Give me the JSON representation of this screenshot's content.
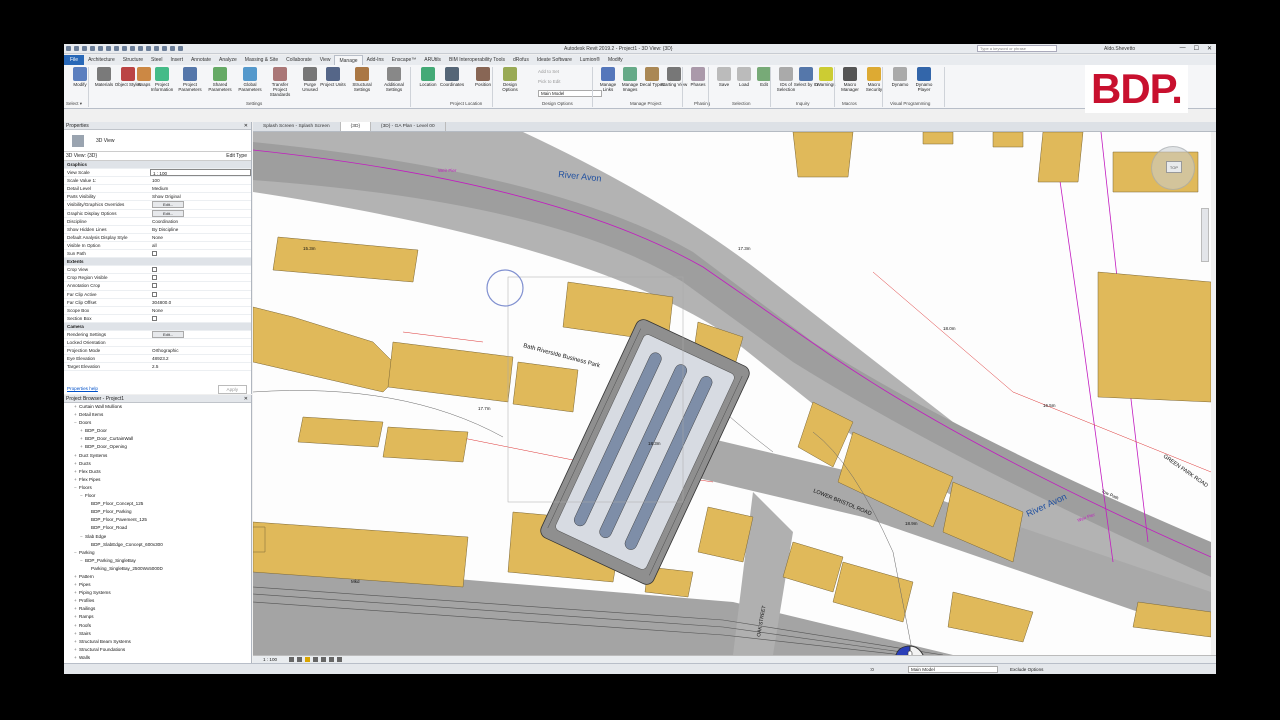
{
  "app": {
    "title": "Autodesk Revit 2019.2 - Project1 - 3D View: {3D}",
    "search_placeholder": "Type a keyword or phrase",
    "user": "Aldo.Shevetto",
    "brand_logo": "BDP."
  },
  "ribbon_tabs": [
    "File",
    "Architecture",
    "Structure",
    "Steel",
    "Insert",
    "Annotate",
    "Analyze",
    "Massing & Site",
    "Collaborate",
    "View",
    "Manage",
    "Add-Ins",
    "Enscape™",
    "ARUtils",
    "BIM Interoperability Tools",
    "dRofus",
    "Ideate Software",
    "Lumion®",
    "Modify"
  ],
  "active_tab": "Manage",
  "ribbon": {
    "buttons": [
      {
        "label": "Modify",
        "icon": "cursor-icon"
      },
      {
        "label": "Materials",
        "icon": "materials-icon"
      },
      {
        "label": "Object Styles",
        "icon": "object-styles-icon"
      },
      {
        "label": "Snaps",
        "icon": "snaps-icon"
      },
      {
        "label": "Project Information",
        "icon": "project-info-icon"
      },
      {
        "label": "Project Parameters",
        "icon": "project-params-icon"
      },
      {
        "label": "Shared Parameters",
        "icon": "shared-params-icon"
      },
      {
        "label": "Global Parameters",
        "icon": "global-params-icon"
      },
      {
        "label": "Transfer Project Standards",
        "icon": "transfer-icon"
      },
      {
        "label": "Purge Unused",
        "icon": "purge-icon"
      },
      {
        "label": "Project Units",
        "icon": "units-icon"
      },
      {
        "label": "Structural Settings",
        "icon": "structural-icon"
      },
      {
        "label": "Additional Settings",
        "icon": "additional-icon"
      },
      {
        "label": "Location",
        "icon": "location-icon"
      },
      {
        "label": "Coordinates",
        "icon": "coordinates-icon"
      },
      {
        "label": "Position",
        "icon": "position-icon"
      },
      {
        "label": "Design Options",
        "icon": "design-options-icon"
      },
      {
        "label": "Manage Links",
        "icon": "links-icon"
      },
      {
        "label": "Manage Images",
        "icon": "images-icon"
      },
      {
        "label": "Decal Types",
        "icon": "decal-icon"
      },
      {
        "label": "Starting View",
        "icon": "starting-view-icon"
      },
      {
        "label": "Phases",
        "icon": "phases-icon"
      },
      {
        "label": "Save",
        "icon": "save-icon"
      },
      {
        "label": "Load",
        "icon": "load-icon"
      },
      {
        "label": "Edit",
        "icon": "edit-icon"
      },
      {
        "label": "IDs of Selection",
        "icon": "ids-icon"
      },
      {
        "label": "Select by ID",
        "icon": "select-id-icon"
      },
      {
        "label": "Warnings",
        "icon": "warnings-icon"
      },
      {
        "label": "Macro Manager",
        "icon": "macro-manager-icon"
      },
      {
        "label": "Macro Security",
        "icon": "macro-security-icon"
      },
      {
        "label": "Dynamo",
        "icon": "dynamo-icon"
      },
      {
        "label": "Dynamo Player",
        "icon": "dynamo-player-icon"
      }
    ],
    "small_items": [
      "Add to Set",
      "Pick to Edit",
      "Main Model"
    ],
    "groups": [
      "Select ▾",
      "Settings",
      "Project Location",
      "Design Options",
      "Manage Project",
      "Phasing",
      "Selection",
      "Inquiry",
      "Macros",
      "Visual Programming"
    ]
  },
  "properties": {
    "header": "Properties",
    "type_name": "3D View",
    "view_selector": "3D View: {3D}",
    "edit_type": "Edit Type",
    "rows": [
      {
        "k": "Graphics",
        "v": "",
        "cat": true
      },
      {
        "k": "View Scale",
        "v": "1 : 100"
      },
      {
        "k": "Scale Value    1:",
        "v": "100"
      },
      {
        "k": "Detail Level",
        "v": "Medium"
      },
      {
        "k": "Parts Visibility",
        "v": "Show Original"
      },
      {
        "k": "Visibility/Graphics Overrides",
        "v": "Edit...",
        "btn": true
      },
      {
        "k": "Graphic Display Options",
        "v": "Edit...",
        "btn": true
      },
      {
        "k": "Discipline",
        "v": "Coordination"
      },
      {
        "k": "Show Hidden Lines",
        "v": "By Discipline"
      },
      {
        "k": "Default Analysis Display Style",
        "v": "None"
      },
      {
        "k": "Visible In Option",
        "v": "all"
      },
      {
        "k": "Sun Path",
        "v": "",
        "cb": true
      },
      {
        "k": "Extents",
        "v": "",
        "cat": true
      },
      {
        "k": "Crop View",
        "v": "",
        "cb": true
      },
      {
        "k": "Crop Region Visible",
        "v": "",
        "cb": true
      },
      {
        "k": "Annotation Crop",
        "v": "",
        "cb": true
      },
      {
        "k": "Far Clip Active",
        "v": "",
        "cb": true
      },
      {
        "k": "Far Clip Offset",
        "v": "304800.0"
      },
      {
        "k": "Scope Box",
        "v": "None"
      },
      {
        "k": "Section Box",
        "v": "",
        "cb": true
      },
      {
        "k": "Camera",
        "v": "",
        "cat": true
      },
      {
        "k": "Rendering Settings",
        "v": "Edit...",
        "btn": true
      },
      {
        "k": "Locked Orientation",
        "v": ""
      },
      {
        "k": "Projection Mode",
        "v": "Orthographic"
      },
      {
        "k": "Eye Elevation",
        "v": "48923.2"
      },
      {
        "k": "Target Elevation",
        "v": "2.5"
      }
    ],
    "help_link": "Properties help",
    "apply": "Apply"
  },
  "browser": {
    "header": "Project Browser - Project1",
    "items": [
      {
        "t": "Curtain Wall Mullions",
        "d": 1,
        "e": "+"
      },
      {
        "t": "Detail Items",
        "d": 1,
        "e": "+"
      },
      {
        "t": "Doors",
        "d": 1,
        "e": "−"
      },
      {
        "t": "BDP_Door",
        "d": 2,
        "e": "+"
      },
      {
        "t": "BDP_Door_CurtainWall",
        "d": 2,
        "e": "+"
      },
      {
        "t": "BDP_Door_Opening",
        "d": 2,
        "e": "+"
      },
      {
        "t": "Duct Systems",
        "d": 1,
        "e": "+"
      },
      {
        "t": "Ducts",
        "d": 1,
        "e": "+"
      },
      {
        "t": "Flex Ducts",
        "d": 1,
        "e": "+"
      },
      {
        "t": "Flex Pipes",
        "d": 1,
        "e": "+"
      },
      {
        "t": "Floors",
        "d": 1,
        "e": "−"
      },
      {
        "t": "Floor",
        "d": 2,
        "e": "−"
      },
      {
        "t": "BDP_Floor_Concept_125",
        "d": 3,
        "e": ""
      },
      {
        "t": "BDP_Floor_Parking",
        "d": 3,
        "e": ""
      },
      {
        "t": "BDP_Floor_Pavement_125",
        "d": 3,
        "e": ""
      },
      {
        "t": "BDP_Floor_Road",
        "d": 3,
        "e": ""
      },
      {
        "t": "Slab Edge",
        "d": 2,
        "e": "−"
      },
      {
        "t": "BDP_SlabEdge_Concept_600x300",
        "d": 3,
        "e": ""
      },
      {
        "t": "Parking",
        "d": 1,
        "e": "−"
      },
      {
        "t": "BDP_Parking_SingleBay",
        "d": 2,
        "e": "−"
      },
      {
        "t": "Parking_SingleBay_2500Wx5000D",
        "d": 3,
        "e": ""
      },
      {
        "t": "Pattern",
        "d": 1,
        "e": "+"
      },
      {
        "t": "Pipes",
        "d": 1,
        "e": "+"
      },
      {
        "t": "Piping Systems",
        "d": 1,
        "e": "+"
      },
      {
        "t": "Profiles",
        "d": 1,
        "e": "+"
      },
      {
        "t": "Railings",
        "d": 1,
        "e": "+"
      },
      {
        "t": "Ramps",
        "d": 1,
        "e": "+"
      },
      {
        "t": "Roofs",
        "d": 1,
        "e": "+"
      },
      {
        "t": "Stairs",
        "d": 1,
        "e": "+"
      },
      {
        "t": "Structural Beam Systems",
        "d": 1,
        "e": "+"
      },
      {
        "t": "Structural Foundations",
        "d": 1,
        "e": "+"
      },
      {
        "t": "Walls",
        "d": 1,
        "e": "+"
      }
    ]
  },
  "view_tabs": [
    "Splash Screen - Splash Screen",
    "{3D}",
    "{3D} - GA Plan - Level 00"
  ],
  "map_labels": {
    "river1": "River Avon",
    "river2": "River Avon",
    "park": "Bath Riverside Business Park",
    "road1": "LOWER BRISTOL ROAD",
    "road2": "GREEN PARK ROAD",
    "street": "OAK STREET",
    "weir1": "Weir Pier",
    "weir2": "Weir Pier",
    "elev1": "17.3m",
    "elev2": "18.0m",
    "elev3": "17.7m",
    "elev4": "18.3m",
    "elev5": "16.5m",
    "elev6": "18.9m",
    "elev7": "15.3m",
    "ferry": "Tow Path",
    "mkt": "Mkd"
  },
  "viewcube_label": "TOP",
  "status": {
    "scale": "1 : 100",
    "workset": "Main Model",
    "exclude": "Exclude Options",
    "coord": ":0"
  }
}
